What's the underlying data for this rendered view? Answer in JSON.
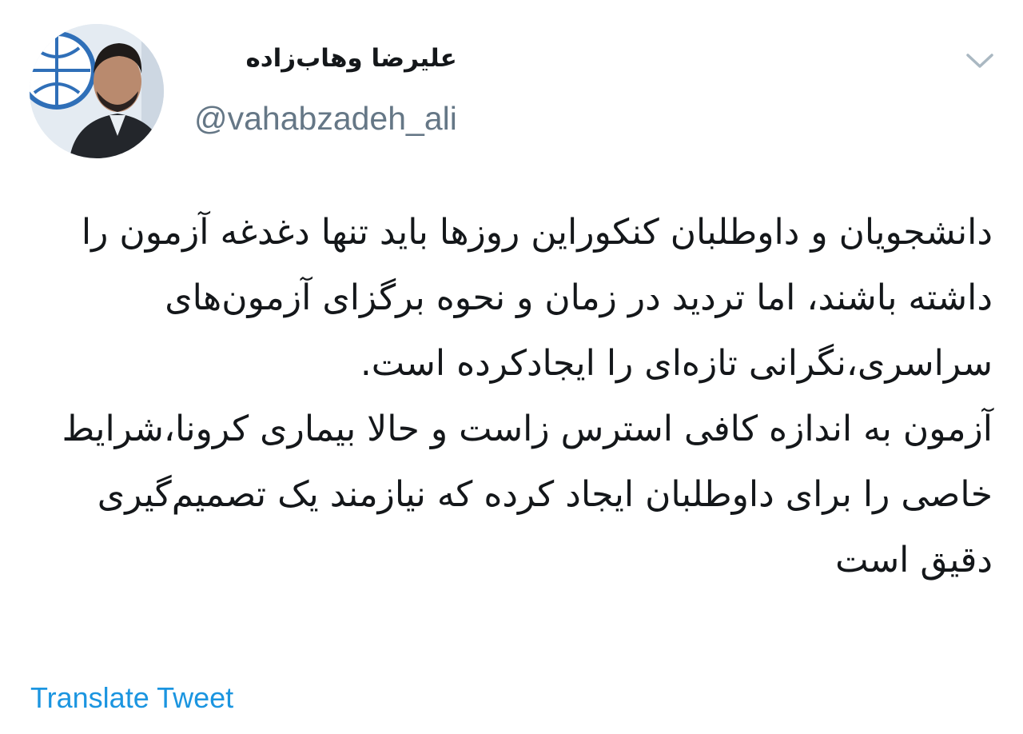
{
  "author": {
    "display_name": "علیرضا وهاب‌زاده",
    "handle": "@vahabzadeh_ali",
    "avatar_icon": "avatar-photo"
  },
  "menu": {
    "icon": "chevron-down-icon"
  },
  "tweet": {
    "paragraphs": [
      "دانشجویان و داوطلبان کنکوراین روزها باید تنها دغدغه آزمون را داشته باشند، اما تردید در زمان و نحوه برگزای آزمون‌های سراسری،نگرانی تازه‌ای را ایجادکرده است.",
      "آزمون به اندازه کافی استرس زاست و حالا بیماری کرونا،شرایط خاصی را برای داوطلبان ایجاد کرده که نیازمند یک تصمیم‌گیری دقیق است"
    ]
  },
  "footer": {
    "translate_label": "Translate Tweet"
  },
  "colors": {
    "text": "#14171a",
    "secondary": "#657786",
    "link": "#1b95e0",
    "chevron": "#aab8c2"
  }
}
